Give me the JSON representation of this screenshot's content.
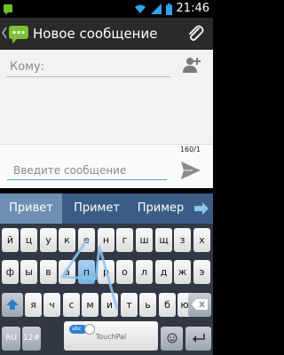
{
  "status_bar": {
    "time": "21:46",
    "icons": [
      "notification-icon",
      "wifi-icon",
      "signal-icon",
      "battery-icon"
    ]
  },
  "action_bar": {
    "title": "Новое сообщение",
    "icons": [
      "up-icon",
      "app-icon",
      "attach-icon"
    ]
  },
  "recipient": {
    "placeholder": "Кому:",
    "icon": "add-contact-icon"
  },
  "compose": {
    "counter": "160/1",
    "placeholder": "Введите сообщение",
    "send_icon": "send-icon"
  },
  "suggestions": {
    "items": [
      "Привет",
      "Примет",
      "Пример"
    ],
    "more_icon": "arrow-right-icon"
  },
  "keyboard": {
    "row1": [
      "й",
      "ц",
      "у",
      "к",
      "е",
      "н",
      "г",
      "ш",
      "щ",
      "з",
      "х"
    ],
    "row2": [
      "ф",
      "ы",
      "в",
      "а",
      "п",
      "р",
      "о",
      "л",
      "д",
      "ж",
      "э"
    ],
    "row3": [
      "я",
      "ч",
      "с",
      "м",
      "и",
      "т",
      "ь",
      "б",
      "ю"
    ],
    "lang_key": "RU",
    "symbols_key": "12#",
    "space_label": "TouchPal",
    "toggle_label": "abc",
    "shift_icon": "shift-icon",
    "backspace_icon": "backspace-icon",
    "emoji_icon": "smiley-icon",
    "enter_icon": "enter-icon",
    "highlighted_key": "п",
    "colors": {
      "background": "#313744",
      "suggest_bar": "#3a5d86",
      "accent": "#4aa3d8",
      "highlight": "#8cc4ee"
    }
  }
}
